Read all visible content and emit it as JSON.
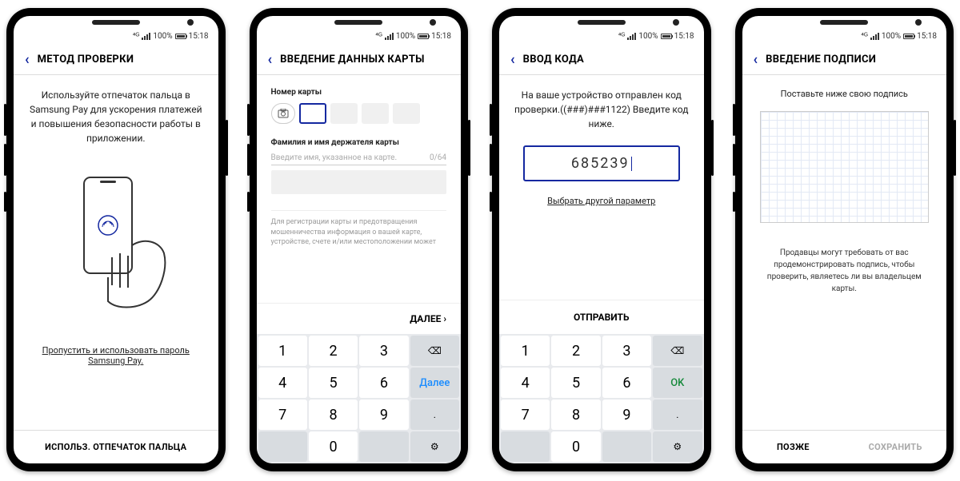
{
  "status": {
    "battery": "100%",
    "time": "15:18"
  },
  "screen1": {
    "title": "МЕТОД ПРОВЕРКИ",
    "body": "Используйте отпечаток пальца в Samsung Pay для ускорения платежей и повышения безопасности работы в приложении.",
    "skip": "Пропустить и использовать пароль Samsung Pay.",
    "bottom": "ИСПОЛЬЗ. ОТПЕЧАТОК ПАЛЬЦА"
  },
  "screen2": {
    "title": "ВВЕДЕНИЕ ДАННЫХ КАРТЫ",
    "card_label": "Номер карты",
    "name_label": "Фамилия и имя держателя карты",
    "name_placeholder": "Введите имя, указанное на карте.",
    "name_counter": "0/64",
    "note": "Для регистрации карты и предотвращения мошенничества информация о вашей карте, устройстве, счете и/или местоположении может",
    "next": "ДАЛЕЕ",
    "keypad": {
      "next": "Далее"
    }
  },
  "screen3": {
    "title": "ВВОД КОДА",
    "body": "На ваше устройство отправлен код проверки.((###)###1122) Введите код ниже.",
    "code": "685239",
    "alt": "Выбрать другой параметр",
    "send": "ОТПРАВИТЬ",
    "keypad": {
      "ok": "OK"
    }
  },
  "screen4": {
    "title": "ВВЕДЕНИЕ ПОДПИСИ",
    "heading": "Поставьте ниже свою подпись",
    "note": "Продавцы могут требовать от вас продемонстрировать подпись, чтобы проверить, являетесь ли вы владельцем карты.",
    "later": "ПОЗЖЕ",
    "save": "СОХРАНИТЬ"
  },
  "keys": {
    "1": "1",
    "2": "2",
    "3": "3",
    "4": "4",
    "5": "5",
    "6": "6",
    "7": "7",
    "8": "8",
    "9": "9",
    "0": "0",
    "dot": ".",
    "bksp": "⌫",
    "gear": "⚙"
  }
}
